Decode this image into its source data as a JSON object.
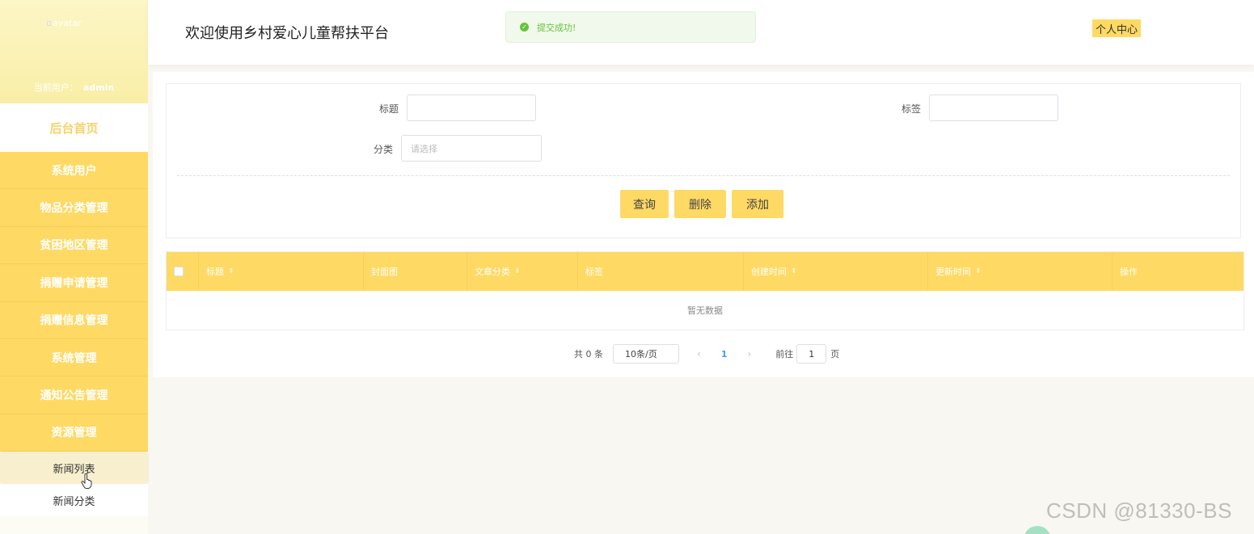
{
  "sidebar": {
    "avatar_alt": "avatar",
    "current_user_label": "当前用户：",
    "current_user_name": "admin",
    "home": "后台首页",
    "menu": [
      {
        "label": "系统用户"
      },
      {
        "label": "物品分类管理"
      },
      {
        "label": "贫困地区管理"
      },
      {
        "label": "捐赠申请管理"
      },
      {
        "label": "捐赠信息管理"
      },
      {
        "label": "系统管理"
      },
      {
        "label": "通知公告管理"
      },
      {
        "label": "资源管理"
      }
    ],
    "submenu": [
      {
        "label": "新闻列表",
        "active": true
      },
      {
        "label": "新闻分类",
        "active": false
      }
    ]
  },
  "header": {
    "title": "欢迎使用乡村爱心儿童帮扶平台",
    "toast": "提交成功!",
    "user_center": "个人中心"
  },
  "search": {
    "title_label": "标题",
    "tag_label": "标签",
    "category_label": "分类",
    "category_placeholder": "请选择",
    "query_button": "查询",
    "delete_button": "删除",
    "add_button": "添加"
  },
  "table": {
    "columns": [
      "标题",
      "封面图",
      "文章分类",
      "标签",
      "创建时间",
      "更新时间",
      "操作"
    ],
    "empty_text": "暂无数据"
  },
  "pagination": {
    "total": "共 0 条",
    "page_size": "10条/页",
    "current_page": "1",
    "goto_label": "前往",
    "goto_value": "1",
    "page_unit": "页"
  },
  "watermark": "CSDN @81330-BS",
  "colors": {
    "accent": "#fed964",
    "success": "#67c23a",
    "page_active": "#409eff"
  }
}
